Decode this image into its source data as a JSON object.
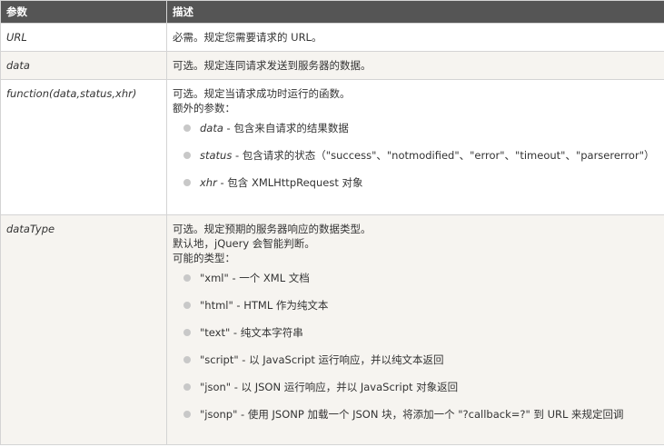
{
  "header": {
    "col1": "参数",
    "col2": "描述"
  },
  "rows": [
    {
      "name": "URL",
      "lines": [
        "必需。规定您需要请求的 URL。"
      ]
    },
    {
      "name": "data",
      "lines": [
        "可选。规定连同请求发送到服务器的数据。"
      ]
    },
    {
      "name": "function(data,status,xhr)",
      "lines": [
        "可选。规定当请求成功时运行的函数。",
        "额外的参数："
      ],
      "options": [
        {
          "term": "data",
          "desc": " - 包含来自请求的结果数据"
        },
        {
          "term": "status",
          "desc": " - 包含请求的状态（\"success\"、\"notmodified\"、\"error\"、\"timeout\"、\"parsererror\"）"
        },
        {
          "term": "xhr",
          "desc": " - 包含 XMLHttpRequest 对象"
        }
      ]
    },
    {
      "name": "dataType",
      "lines": [
        "可选。规定预期的服务器响应的数据类型。",
        "默认地，jQuery 会智能判断。",
        "可能的类型："
      ],
      "options": [
        {
          "text": "\"xml\" - 一个 XML 文档"
        },
        {
          "text": "\"html\" - HTML 作为纯文本"
        },
        {
          "text": "\"text\" - 纯文本字符串"
        },
        {
          "text": "\"script\" - 以 JavaScript 运行响应，并以纯文本返回"
        },
        {
          "text": "\"json\" - 以 JSON 运行响应，并以 JavaScript 对象返回"
        },
        {
          "text": "\"jsonp\" - 使用 JSONP 加载一个 JSON 块，将添加一个 \"?callback=?\" 到 URL 来规定回调"
        }
      ]
    }
  ],
  "colors": {
    "header_bg": "#555555",
    "alt_row_bg": "#f6f4f0",
    "border": "#d4d4d4",
    "bullet": "#c8c8c8"
  }
}
